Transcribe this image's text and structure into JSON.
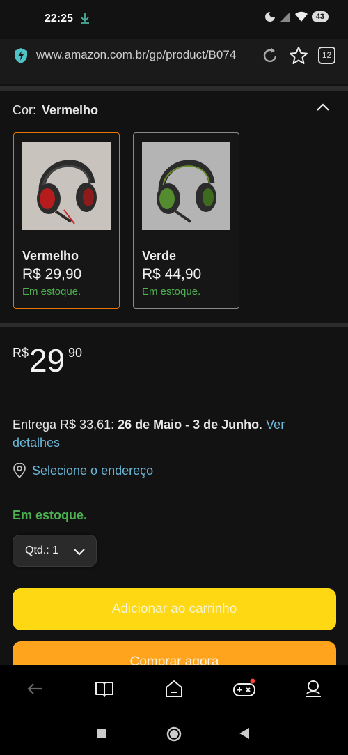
{
  "status": {
    "time": "22:25",
    "battery": "43"
  },
  "browser": {
    "url": "www.amazon.com.br/gp/product/B074",
    "tab_count": "12"
  },
  "product": {
    "color_label": "Cor:",
    "color_selected": "Vermelho",
    "variants": [
      {
        "name": "Vermelho",
        "price": "R$ 29,90",
        "stock": "Em estoque.",
        "accent": "#c62828"
      },
      {
        "name": "Verde",
        "price": "R$ 44,90",
        "stock": "Em estoque.",
        "accent": "#558b2f"
      }
    ],
    "price": {
      "currency": "R$",
      "whole": "29",
      "cents": "90"
    },
    "delivery": {
      "prefix": "Entrega R$ 33,61: ",
      "dates": "26 de Maio - 3 de Junho",
      "sep": ". ",
      "link": "Ver detalhes"
    },
    "location_link": "Selecione o endereço",
    "availability": "Em estoque.",
    "quantity_label": "Qtd.: 1",
    "add_to_cart": "Adicionar ao carrinho",
    "buy_now": "Comprar agora"
  },
  "colors": {
    "accent_orange": "#e77600",
    "cart_yellow": "#ffd814",
    "buy_orange": "#ffa41c",
    "stock_green": "#4caf50",
    "link_blue": "#6ab7d8"
  },
  "icons": [
    "download-icon",
    "dnd-icon",
    "signal-icon",
    "wifi-icon",
    "shield-icon",
    "refresh-icon",
    "star-icon",
    "chevron-up-icon",
    "location-pin-icon",
    "chevron-down-icon",
    "back-arrow-icon",
    "book-icon",
    "home-icon",
    "gamepad-icon",
    "profile-icon",
    "square-icon",
    "circle-icon",
    "triangle-back-icon"
  ]
}
